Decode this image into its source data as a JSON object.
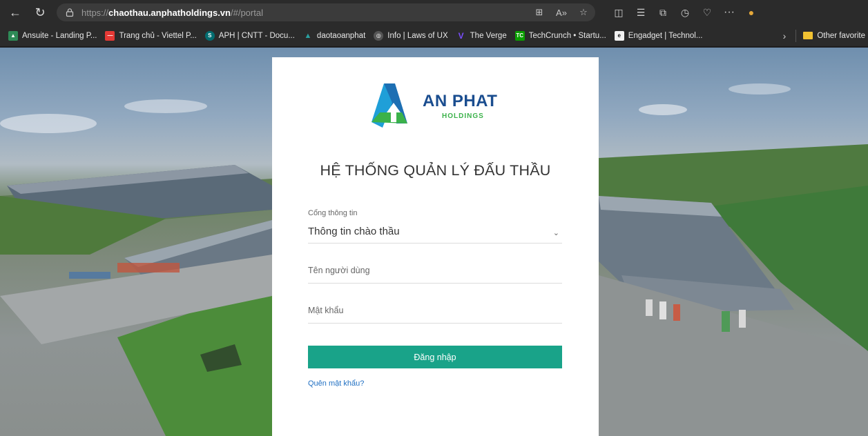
{
  "browser": {
    "url_protocol": "https://",
    "url_domain": "chaothau.anphatholdings.vn",
    "url_path": "/#/portal",
    "bookmarks": [
      {
        "label": "Ansuite - Landing P...",
        "icon": "ansuite-icon",
        "color": "#2e8b57"
      },
      {
        "label": "Trang chủ - Viettel P...",
        "icon": "viettel-icon",
        "color": "#e53935"
      },
      {
        "label": "APH | CNTT - Docu...",
        "icon": "sharepoint-icon",
        "color": "#036c70"
      },
      {
        "label": "daotaoanphat",
        "icon": "anphat-icon",
        "color": "#2aa0a0"
      },
      {
        "label": "Info | Laws of UX",
        "icon": "lawsofux-icon",
        "color": "#555555"
      },
      {
        "label": "The Verge",
        "icon": "verge-icon",
        "color": "#5b2bff"
      },
      {
        "label": "TechCrunch • Startu...",
        "icon": "techcrunch-icon",
        "color": "#0a9e01"
      },
      {
        "label": "Engadget | Technol...",
        "icon": "engadget-icon",
        "color": "#111111"
      }
    ],
    "other_favorites": "Other favorite"
  },
  "card": {
    "brand_main": "AN PHAT",
    "brand_sub": "HOLDINGS",
    "title": "HỆ THỐNG QUẢN LÝ ĐẤU THẦU",
    "portal_label": "Cổng thông tin",
    "portal_value": "Thông tin chào thầu",
    "username_placeholder": "Tên người dùng",
    "password_placeholder": "Mật khẩu",
    "login_label": "Đăng nhập",
    "forgot_label": "Quên mật khẩu?"
  },
  "colors": {
    "primary_button": "#19a389",
    "link": "#1f6fc2",
    "brand_blue": "#1a4d8f",
    "brand_green": "#3bb24a"
  }
}
